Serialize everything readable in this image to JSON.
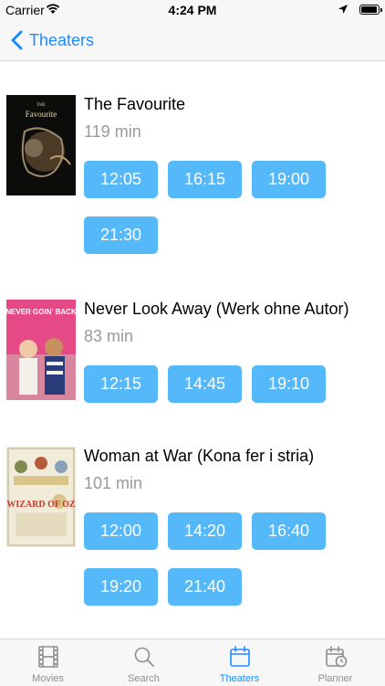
{
  "status_bar": {
    "carrier": "Carrier",
    "time": "4:24 PM"
  },
  "nav": {
    "back_label": "Theaters"
  },
  "movies": [
    {
      "title": "The Favourite",
      "runtime": "119 min",
      "times": [
        "12:05",
        "16:15",
        "19:00",
        "21:30"
      ],
      "poster": {
        "text": "Favourite",
        "subtext": "THE"
      }
    },
    {
      "title": "Never Look Away (Werk ohne Autor)",
      "runtime": "83 min",
      "times": [
        "12:15",
        "14:45",
        "19:10"
      ],
      "poster": {
        "text": "NEVER GOIN' BACK"
      }
    },
    {
      "title": "Woman at War (Kona fer i stria)",
      "runtime": "101 min",
      "times": [
        "12:00",
        "14:20",
        "16:40",
        "19:20",
        "21:40"
      ],
      "poster": {
        "text": "WIZARD OF OZ"
      }
    }
  ],
  "tabs": [
    {
      "label": "Movies",
      "icon": "film-icon",
      "active": false
    },
    {
      "label": "Search",
      "icon": "search-icon",
      "active": false
    },
    {
      "label": "Theaters",
      "icon": "calendar-icon",
      "active": true
    },
    {
      "label": "Planner",
      "icon": "planner-icon",
      "active": false
    }
  ],
  "colors": {
    "accent": "#1a8cff",
    "time_button": "#55b8f8",
    "secondary_text": "#9a9a9a"
  }
}
